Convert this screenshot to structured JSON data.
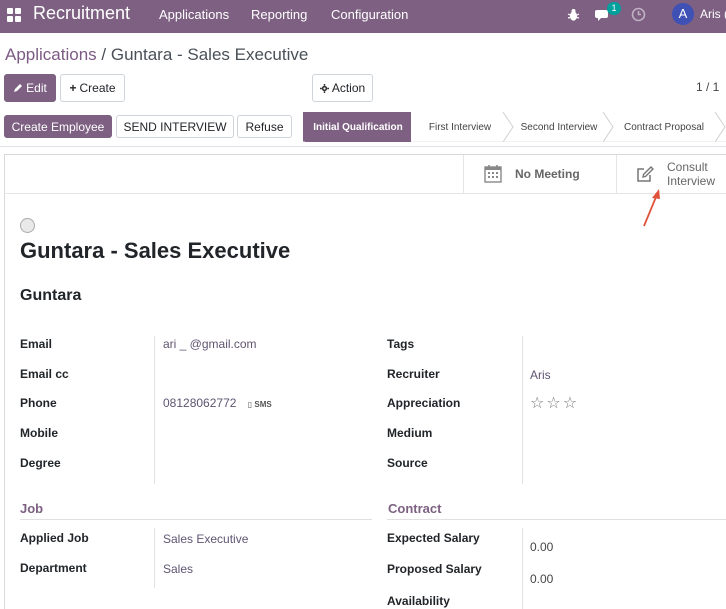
{
  "navbar": {
    "app_name": "Recruitment",
    "menu": [
      "Applications",
      "Reporting",
      "Configuration"
    ],
    "messages_count": "1",
    "avatar_letter": "A",
    "user_name": "Aris (",
    "icons": [
      "apps-grid-icon",
      "bug-icon",
      "chat-icon",
      "clock-icon"
    ]
  },
  "breadcrumb": {
    "parent": "Applications",
    "separator": " / ",
    "current": "Guntara - Sales Executive"
  },
  "toolbar": {
    "edit": "Edit",
    "create": "Create",
    "action": "Action",
    "pager": "1 / 1"
  },
  "statusbar": {
    "buttons": [
      "Create Employee",
      "SEND INTERVIEW",
      "Refuse"
    ],
    "stages": [
      "Initial Qualification",
      "First Interview",
      "Second Interview",
      "Contract Proposal"
    ],
    "active_stage": "Initial Qualification"
  },
  "button_box": {
    "meeting": "No Meeting",
    "consult_line1": "Consult",
    "consult_line2": "Interview"
  },
  "form": {
    "title": "Guntara - Sales Executive",
    "applicant_name": "Guntara",
    "left_fields": [
      {
        "label": "Email",
        "value": "ari _          @gmail.com"
      },
      {
        "label": "Email cc",
        "value": ""
      },
      {
        "label": "Phone",
        "value": "08128062772",
        "extra": "SMS"
      },
      {
        "label": "Mobile",
        "value": ""
      },
      {
        "label": "Degree",
        "value": ""
      }
    ],
    "right_fields": [
      {
        "label": "Tags",
        "value": ""
      },
      {
        "label": "Recruiter",
        "value": "Aris"
      },
      {
        "label": "Appreciation",
        "value": "☆☆☆"
      },
      {
        "label": "Medium",
        "value": ""
      },
      {
        "label": "Source",
        "value": ""
      }
    ],
    "job_section": {
      "title": "Job",
      "fields": [
        {
          "label": "Applied Job",
          "value": "Sales Executive"
        },
        {
          "label": "Department",
          "value": "Sales"
        }
      ]
    },
    "contract_section": {
      "title": "Contract",
      "fields": [
        {
          "label": "Expected Salary",
          "value": "0.00"
        },
        {
          "label": "Proposed Salary",
          "value": "0.00"
        },
        {
          "label": "Availability",
          "value": ""
        }
      ]
    }
  },
  "colors": {
    "brand": "#7d6082",
    "annotation_arrow": "#e0533a"
  }
}
